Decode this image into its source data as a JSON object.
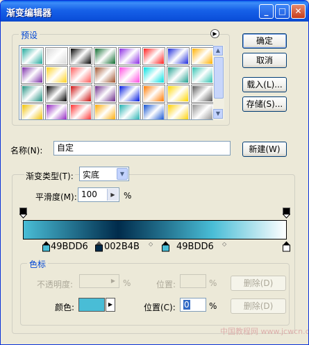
{
  "window": {
    "title": "渐变编辑器"
  },
  "presets": {
    "label": "预设",
    "swatches": [
      [
        "#1FA89B",
        "#d9d9d9",
        "#000000",
        "#0E6B2F",
        "#8A2BE2",
        "#FF2020",
        "#1E2BDB",
        "#FFB000"
      ],
      [
        "#7A2CA8",
        "#FFD21F",
        "#FF5A5A",
        "#A0522D",
        "#FF4AE0",
        "#00E0E0",
        "#20A090",
        "#2FC2B0"
      ],
      [
        "#1F9080",
        "#000000",
        "#CC1010",
        "#6C2B8A",
        "#0018E0",
        "#FF7A00",
        "#FFD700",
        "#5A5A5A"
      ],
      [
        "#F0C000",
        "#9020C0",
        "#FF3030",
        "#FFAA00",
        "#20B0B0",
        "#1050D0",
        "#FFD000",
        "#909090"
      ]
    ]
  },
  "buttons": {
    "ok": "确定",
    "cancel": "取消",
    "load": "载入(L)...",
    "save": "存储(S)...",
    "new": "新建(W)",
    "delete_opacity": "删除(D)",
    "delete_color": "删除(D)"
  },
  "name": {
    "label": "名称(N):",
    "value": "自定"
  },
  "gradient_type": {
    "label": "渐变类型(T):",
    "value": "实底"
  },
  "smoothness": {
    "label": "平滑度(M):",
    "value": "100",
    "unit": "%"
  },
  "gradient": {
    "colors": [
      "#49BDD6",
      "#002B4B",
      "#49BDD6",
      "#FFFFFF"
    ],
    "stop_labels": [
      "49BDD6",
      "002B4B",
      "49BDD6"
    ],
    "positions_pct": [
      0,
      36,
      72,
      100
    ]
  },
  "stops_group": {
    "label": "色标",
    "opacity_label": "不透明度:",
    "opacity_unit": "%",
    "position_label_disabled": "位置:",
    "position_unit_disabled": "%",
    "color_label": "颜色:",
    "color_value": "#49BDD6",
    "position_label": "位置(C):",
    "position_value": "0",
    "position_unit": "%"
  },
  "watermark": "中国教程网 www.jcwcn.com"
}
